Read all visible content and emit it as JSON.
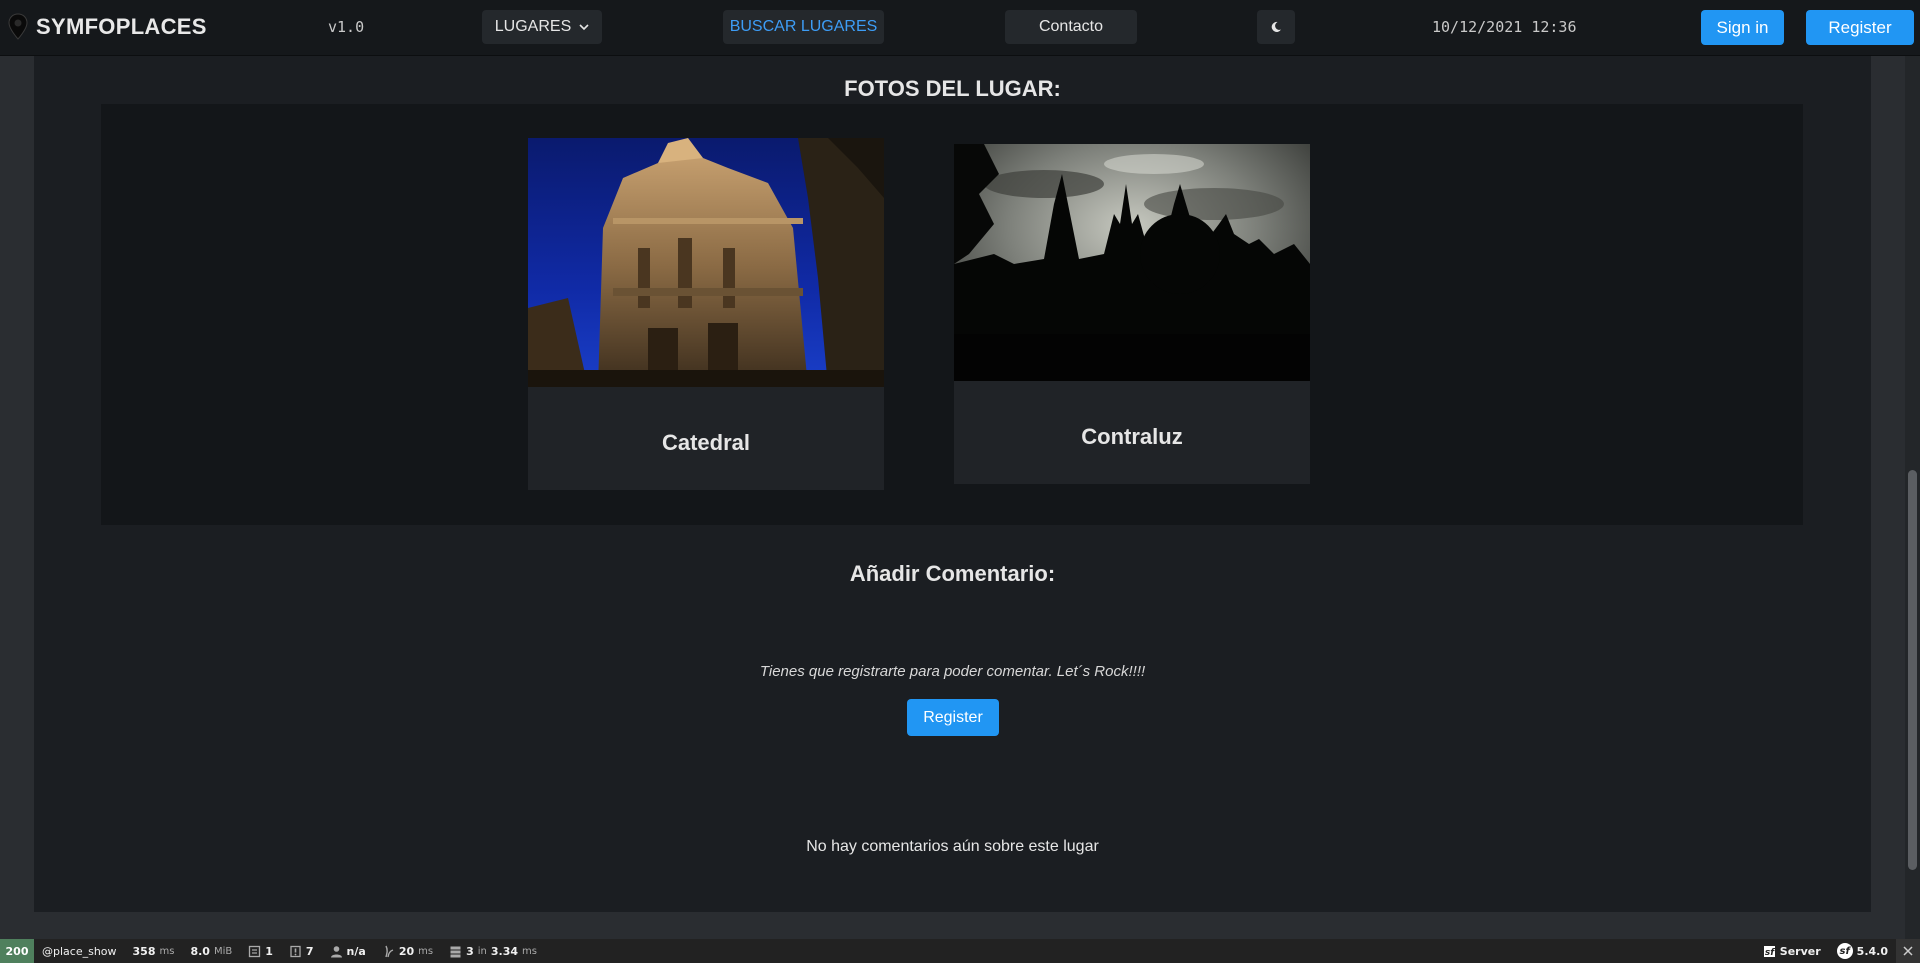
{
  "navbar": {
    "brand": "SYMFOPLACES",
    "version": "v1.0",
    "lugares_label": "LUGARES",
    "buscar_label": "BUSCAR LUGARES",
    "contacto_label": "Contacto",
    "datetime": "10/12/2021 12:36",
    "signin_label": "Sign in",
    "register_label": "Register",
    "accent_color": "#2196f3"
  },
  "photos": {
    "title": "FOTOS DEL LUGAR:",
    "cards": [
      {
        "caption": "Catedral"
      },
      {
        "caption": "Contraluz"
      }
    ]
  },
  "comments": {
    "title": "Añadir Comentario:",
    "login_message": "Tienes que registrarte para poder comentar. Let´s Rock!!!!",
    "register_label": "Register",
    "empty_message": "No hay comentarios aún sobre este lugar"
  },
  "debug_toolbar": {
    "status_code": "200",
    "route": "@place_show",
    "time_value": "358",
    "time_unit": "ms",
    "memory_value": "8.0",
    "memory_unit": "MiB",
    "forms_count": "1",
    "logs_count": "7",
    "user": "n/a",
    "twig_value": "20",
    "twig_unit": "ms",
    "db_queries": "3",
    "db_in": "in",
    "db_time": "3.34",
    "db_unit": "ms",
    "server_label": "Server",
    "symfony_version": "5.4.0",
    "status_color": "#4f805d"
  }
}
